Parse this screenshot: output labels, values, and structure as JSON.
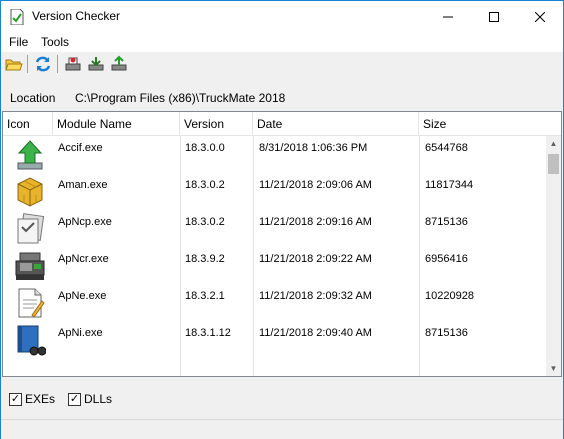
{
  "window": {
    "title": "Version Checker"
  },
  "menu": {
    "file": "File",
    "tools": "Tools"
  },
  "toolbar": {
    "icons": [
      "open-folder-icon",
      "refresh-icon",
      "print-icon",
      "download-icon",
      "upload-icon"
    ]
  },
  "location": {
    "label": "Location",
    "value": "C:\\Program Files (x86)\\TruckMate 2018"
  },
  "table": {
    "columns": [
      "Icon",
      "Module Name",
      "Version",
      "Date",
      "Size"
    ],
    "rows": [
      {
        "icon": "green-arrow-icon",
        "module": "Accif.exe",
        "version": "18.3.0.0",
        "date": "8/31/2018 1:06:36 PM",
        "size": "6544768"
      },
      {
        "icon": "yellow-cube-icon",
        "module": "Aman.exe",
        "version": "18.3.0.2",
        "date": "11/21/2018 2:09:06 AM",
        "size": "11817344"
      },
      {
        "icon": "document-stack-icon",
        "module": "ApNcp.exe",
        "version": "18.3.0.2",
        "date": "11/21/2018 2:09:16 AM",
        "size": "8715136"
      },
      {
        "icon": "cash-register-icon",
        "module": "ApNcr.exe",
        "version": "18.3.9.2",
        "date": "11/21/2018 2:09:22 AM",
        "size": "6956416"
      },
      {
        "icon": "notepad-icon",
        "module": "ApNe.exe",
        "version": "18.3.2.1",
        "date": "11/21/2018 2:09:32 AM",
        "size": "10220928"
      },
      {
        "icon": "book-binoculars-icon",
        "module": "ApNi.exe",
        "version": "18.3.1.12",
        "date": "11/21/2018 2:09:40 AM",
        "size": "8715136"
      }
    ]
  },
  "filters": {
    "exes": "EXEs",
    "exes_checked": true,
    "dlls": "DLLs",
    "dlls_checked": true
  }
}
